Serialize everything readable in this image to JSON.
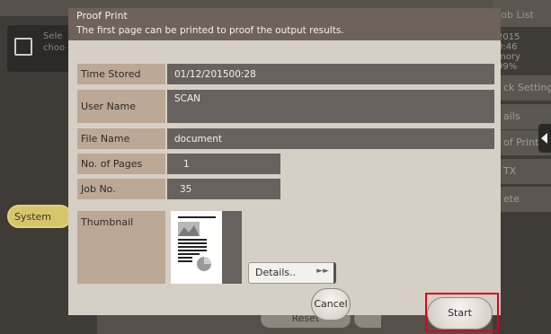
{
  "background": {
    "top_tab": "Job List",
    "left_panel_text": [
      "Sele",
      "choo"
    ],
    "status_lines": [
      "2015",
      "0:46",
      "mory",
      "99%"
    ],
    "right_buttons": [
      "ck Setting",
      "ails",
      "of Print",
      "TX",
      "ete"
    ],
    "system_label": "System",
    "reset_label": "Reset"
  },
  "dialog": {
    "title": "Proof Print",
    "message": "The first page can be printed to proof the output results.",
    "fields": {
      "time_stored": {
        "label": "Time Stored",
        "value": "01/12/201500:28"
      },
      "user_name": {
        "label": "User Name",
        "value": "SCAN"
      },
      "file_name": {
        "label": "File Name",
        "value": "document"
      },
      "pages": {
        "label": "No. of Pages",
        "value": "1"
      },
      "job_no": {
        "label": "Job No.",
        "value": "35"
      }
    },
    "thumbnail_label": "Thumbnail",
    "details_label": "Details..",
    "cancel_label": "Cancel",
    "start_label": "Start"
  },
  "colors": {
    "header": "#6e625a",
    "label_bg": "#bca895",
    "value_bg": "#67625d",
    "highlight": "#e0001b"
  }
}
